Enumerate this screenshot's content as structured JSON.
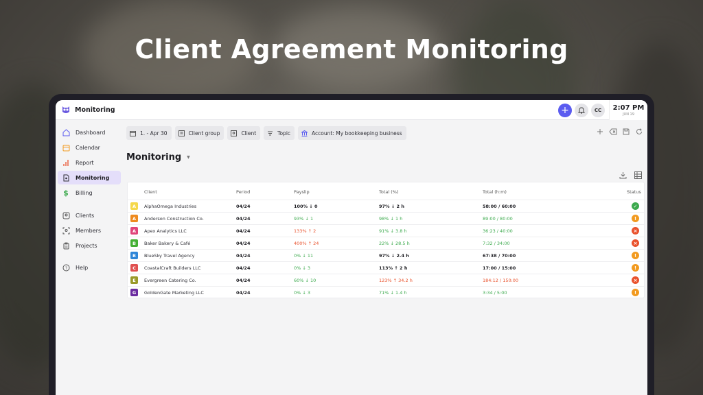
{
  "hero_title": "Client Agreement Monitoring",
  "app": {
    "title": "Monitoring",
    "avatar_initials": "CC",
    "clock_time": "2:07 PM",
    "clock_date": "JUN 19"
  },
  "sidebar": {
    "items": [
      {
        "label": "Dashboard",
        "icon": "home-icon"
      },
      {
        "label": "Calendar",
        "icon": "calendar-icon"
      },
      {
        "label": "Report",
        "icon": "bar-chart-icon"
      },
      {
        "label": "Monitoring",
        "icon": "document-icon",
        "active": true
      },
      {
        "label": "Billing",
        "icon": "dollar-icon"
      },
      {
        "label": "Clients",
        "icon": "clients-icon"
      },
      {
        "label": "Members",
        "icon": "members-icon"
      },
      {
        "label": "Projects",
        "icon": "clipboard-icon"
      },
      {
        "label": "Help",
        "icon": "help-icon"
      }
    ]
  },
  "filters": [
    {
      "label": "1. - Apr 30",
      "icon": "calendar-icon"
    },
    {
      "label": "Client group",
      "icon": "group-icon"
    },
    {
      "label": "Client",
      "icon": "client-icon"
    },
    {
      "label": "Topic",
      "icon": "topic-icon"
    },
    {
      "label": "Account: My bookkeeping business",
      "icon": "bank-icon"
    }
  ],
  "page": {
    "title": "Monitoring"
  },
  "table": {
    "headers": {
      "client": "Client",
      "period": "Period",
      "payslip": "Payslip",
      "total_pct": "Total (%)",
      "total_hm": "Total (h:m)",
      "status": "Status"
    },
    "colors": {
      "green": "#3daa4e",
      "red": "#e9522d",
      "orange": "#f29a1f",
      "accent": "#5b5cf0"
    },
    "rows": [
      {
        "letter": "A",
        "badge": "#f5d84a",
        "name": "AlphaOmega Industries",
        "period": "04/24",
        "payslip": "100% ↓ 0",
        "payslip_tone": "black",
        "total": "97% ↓ 2 h",
        "total_tone": "black",
        "hm": "58:00 / 60:00",
        "hm_tone": "black",
        "status": "ok"
      },
      {
        "letter": "A",
        "badge": "#ee8a1f",
        "name": "Anderson Construction Co.",
        "period": "04/24",
        "payslip": "93% ↓ 1",
        "payslip_tone": "green",
        "total": "98% ↓ 1 h",
        "total_tone": "green",
        "hm": "89:00 / 80:00",
        "hm_tone": "green",
        "status": "warn"
      },
      {
        "letter": "A",
        "badge": "#e0447a",
        "name": "Apex Analytics LLC",
        "period": "04/24",
        "payslip": "133% ↑ 2",
        "payslip_tone": "red",
        "total": "91% ↓ 3.8 h",
        "total_tone": "green",
        "hm": "36:23 / 40:00",
        "hm_tone": "green",
        "status": "error"
      },
      {
        "letter": "B",
        "badge": "#45b035",
        "name": "Baker Bakery & Café",
        "period": "04/24",
        "payslip": "400% ↑ 24",
        "payslip_tone": "red",
        "total": "22% ↓ 28.5 h",
        "total_tone": "green",
        "hm": "7:32 / 34:00",
        "hm_tone": "green",
        "status": "error"
      },
      {
        "letter": "B",
        "badge": "#2f86d8",
        "name": "BlueSky Travel Agency",
        "period": "04/24",
        "payslip": "0% ↓ 11",
        "payslip_tone": "green",
        "total": "97% ↓ 2.4 h",
        "total_tone": "black",
        "hm": "67:38 / 70:00",
        "hm_tone": "black",
        "status": "warn"
      },
      {
        "letter": "C",
        "badge": "#e05050",
        "name": "CoastalCraft Builders LLC",
        "period": "04/24",
        "payslip": "0% ↓ 3",
        "payslip_tone": "green",
        "total": "113% ↑ 2 h",
        "total_tone": "black",
        "hm": "17:00 / 15:00",
        "hm_tone": "black",
        "status": "warn"
      },
      {
        "letter": "E",
        "badge": "#9a9a2a",
        "name": "Evergreen Catering Co.",
        "period": "04/24",
        "payslip": "60% ↓ 10",
        "payslip_tone": "green",
        "total": "123% ↑ 34.2 h",
        "total_tone": "red",
        "hm": "184:12 / 150:00",
        "hm_tone": "red",
        "status": "error"
      },
      {
        "letter": "G",
        "badge": "#6b2ca0",
        "name": "GoldenGate Marketing LLC",
        "period": "04/24",
        "payslip": "0% ↓ 3",
        "payslip_tone": "green",
        "total": "71% ↓ 1.4 h",
        "total_tone": "green",
        "hm": "3:34 / 5:00",
        "hm_tone": "green",
        "status": "warn"
      }
    ]
  }
}
